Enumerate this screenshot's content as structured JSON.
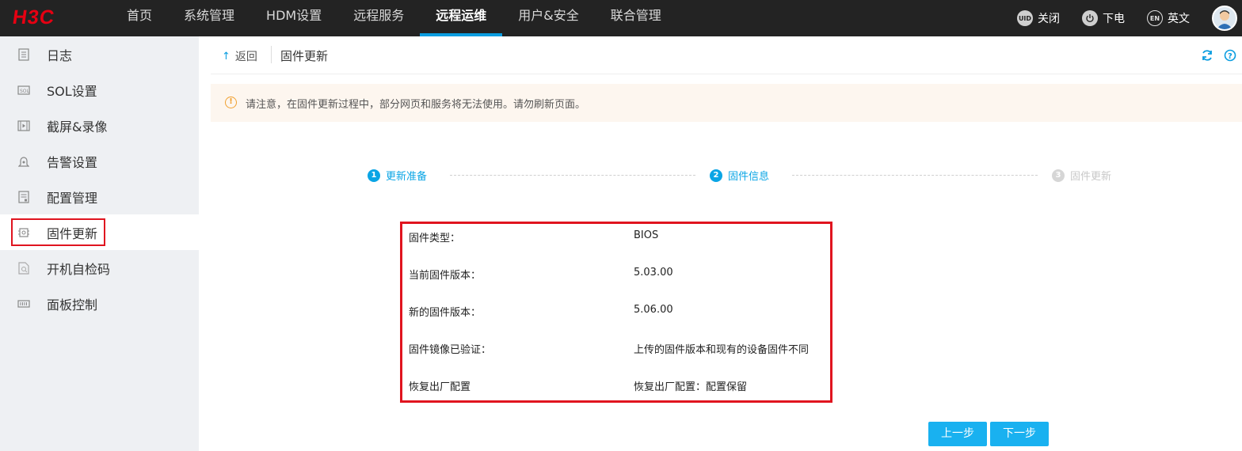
{
  "brand": {
    "logo_text": "H3C",
    "logo_color": "#e60012"
  },
  "nav": {
    "items": [
      {
        "label": "首页"
      },
      {
        "label": "系统管理"
      },
      {
        "label": "HDM设置"
      },
      {
        "label": "远程服务"
      },
      {
        "label": "远程运维",
        "active": true
      },
      {
        "label": "用户&安全"
      },
      {
        "label": "联合管理"
      }
    ],
    "accent_color": "#0a9de0"
  },
  "top_right": {
    "uid_icon": "UID",
    "uid_label": "关闭",
    "power_label": "下电",
    "lang_icon": "EN",
    "lang_label": "英文"
  },
  "sidebar": {
    "items": [
      {
        "label": "日志",
        "icon": "log-icon"
      },
      {
        "label": "SOL设置",
        "icon": "sol-icon"
      },
      {
        "label": "截屏&录像",
        "icon": "video-icon"
      },
      {
        "label": "告警设置",
        "icon": "alarm-bell-icon"
      },
      {
        "label": "配置管理",
        "icon": "config-icon"
      },
      {
        "label": "固件更新",
        "icon": "chip-icon",
        "active": true
      },
      {
        "label": "开机自检码",
        "icon": "post-code-icon"
      },
      {
        "label": "面板控制",
        "icon": "panel-icon"
      }
    ]
  },
  "toolbar": {
    "back_label": "返回",
    "title": "固件更新"
  },
  "notice": {
    "text": "请注意，在固件更新过程中，部分网页和服务将无法使用。请勿刷新页面。"
  },
  "steps": [
    {
      "num": "1",
      "label": "更新准备",
      "state": "done"
    },
    {
      "num": "2",
      "label": "固件信息",
      "state": "current"
    },
    {
      "num": "3",
      "label": "固件更新",
      "state": "pending"
    }
  ],
  "firmware_info": [
    {
      "key": "固件类型：",
      "value": "BIOS"
    },
    {
      "key": "当前固件版本：",
      "value": "5.03.00"
    },
    {
      "key": "新的固件版本：",
      "value": "5.06.00"
    },
    {
      "key": "固件镜像已验证：",
      "value": "上传的固件版本和现有的设备固件不同"
    },
    {
      "key": "恢复出厂配置",
      "value": "恢复出厂配置：配置保留"
    }
  ],
  "buttons": {
    "prev_label": "上一步",
    "next_label": "下一步"
  }
}
